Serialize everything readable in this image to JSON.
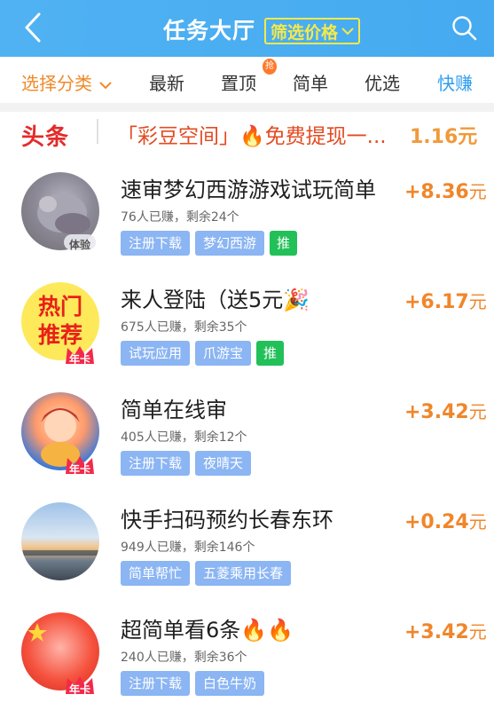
{
  "header": {
    "title": "任务大厅",
    "filter_label": "筛选价格",
    "back_icon": "chevron-left-icon",
    "search_icon": "search-icon"
  },
  "tabs": [
    {
      "label": "选择分类",
      "state": "active"
    },
    {
      "label": "最新"
    },
    {
      "label": "置顶",
      "badge": "抢"
    },
    {
      "label": "简单"
    },
    {
      "label": "优选"
    },
    {
      "label": "快赚",
      "state": "highlight"
    }
  ],
  "ticker": {
    "logo": "头条",
    "text": "「彩豆空间」🔥免费提现一...",
    "amount": "1.16元"
  },
  "tasks": [
    {
      "title": "速审梦幻西游游戏试玩简单",
      "meta": "76人已赚，剩余24个",
      "tags": [
        "注册下载",
        "梦幻西游"
      ],
      "recommend": "推",
      "reward": "+8.36",
      "unit": "元",
      "avatar_badge": "体验"
    },
    {
      "title": "来人登陆（送5元🎉",
      "meta": "675人已赚，剩余35个",
      "tags": [
        "试玩应用",
        "爪游宝"
      ],
      "recommend": "推",
      "reward": "+6.17",
      "unit": "元",
      "avatar_text": "热门推荐",
      "avatar_badge": "年卡"
    },
    {
      "title": "简单在线审",
      "meta": "405人已赚，剩余12个",
      "tags": [
        "注册下载",
        "夜晴天"
      ],
      "reward": "+3.42",
      "unit": "元",
      "avatar_badge": "年卡"
    },
    {
      "title": "快手扫码预约长春东环",
      "meta": "949人已赚，剩余146个",
      "tags": [
        "简单帮忙",
        "五菱乘用长春"
      ],
      "reward": "+0.24",
      "unit": "元"
    },
    {
      "title": "超简单看6条🔥🔥",
      "meta": "240人已赚，剩余36个",
      "tags": [
        "注册下载",
        "白色牛奶"
      ],
      "reward": "+3.42",
      "unit": "元",
      "avatar_badge": "年卡"
    }
  ],
  "colors": {
    "header": "#4aaef1",
    "accent": "#f08a2a",
    "tag": "#8bb5f3",
    "recommend": "#22c058"
  }
}
